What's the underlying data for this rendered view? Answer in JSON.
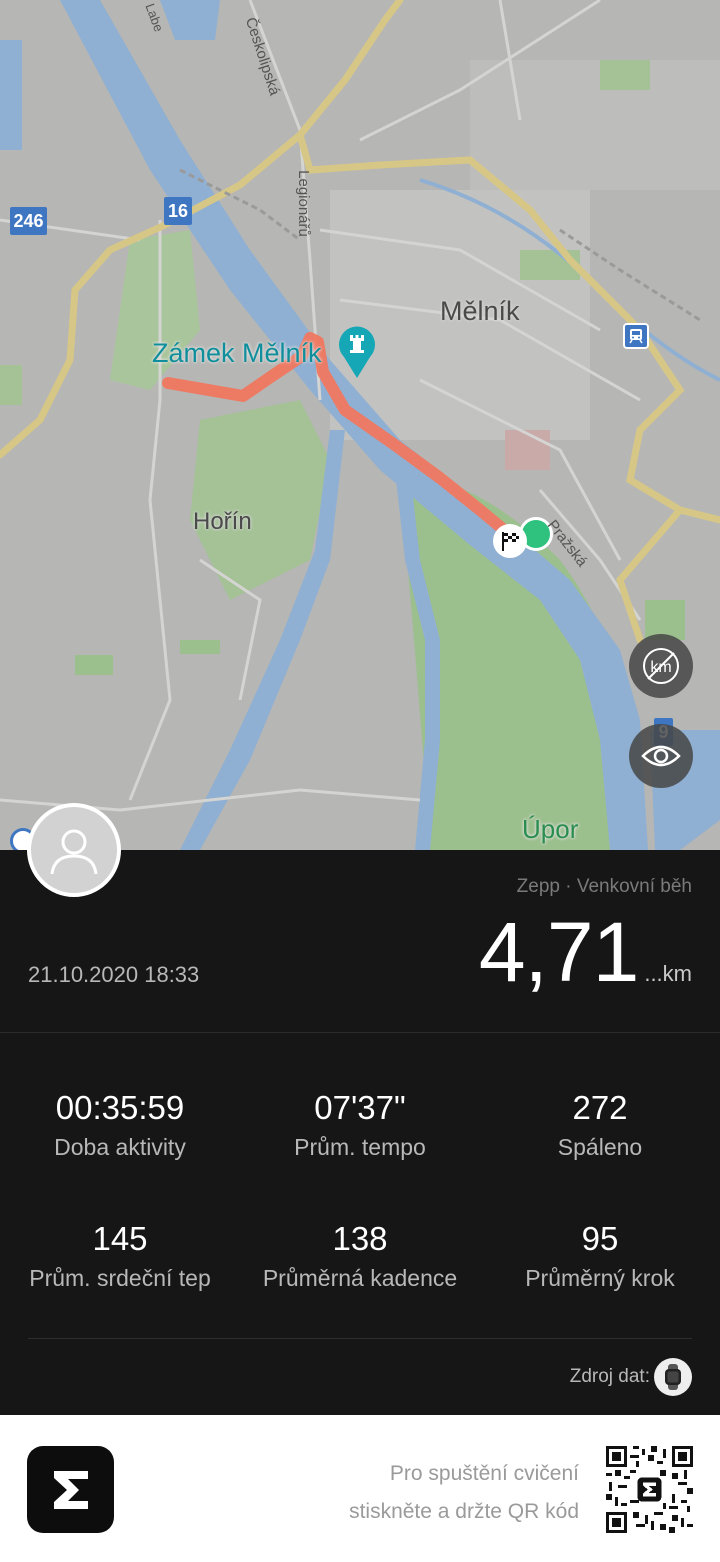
{
  "map": {
    "labels": {
      "city_melnik": "Mělník",
      "city_horin": "Hořín",
      "village_upor": "Úpor",
      "poi_zamek": "Zámek Mělník",
      "street_ceskolipska": "Českolipská",
      "street_legionaru": "Legionářů",
      "street_prazska": "Pražská",
      "river_labe": "Labe"
    },
    "road_shields": {
      "r246": "246",
      "r16": "16",
      "r9": "9"
    },
    "buttons": {
      "km_toggle_icon": "km-off-icon",
      "view_toggle_icon": "eye-icon"
    },
    "colors": {
      "route": "#f07860",
      "start_marker": "#2ec27e",
      "water": "#8fb0d2",
      "major_road": "#d7c787",
      "park": "#9cbf8e"
    }
  },
  "activity": {
    "source_app": "Zepp · Venkovní běh",
    "date": "21.10.2020 18:33",
    "distance_value": "4,71",
    "distance_unit": "...km"
  },
  "stats": [
    {
      "value": "00:35:59",
      "label": "Doba aktivity"
    },
    {
      "value": "07'37\"",
      "label": "Prům. tempo"
    },
    {
      "value": "272",
      "label": "Spáleno"
    },
    {
      "value": "145",
      "label": "Prům. srdeční tep"
    },
    {
      "value": "138",
      "label": "Průměrná kadence"
    },
    {
      "value": "95",
      "label": "Průměrný krok"
    }
  ],
  "data_source": {
    "label": "Zdroj dat:",
    "icon": "watch-icon"
  },
  "footer": {
    "line1": "Pro spuštění cvičení",
    "line2": "stiskněte a držte QR kód",
    "logo_icon": "zepp-logo",
    "qr_icon": "qr-code"
  }
}
